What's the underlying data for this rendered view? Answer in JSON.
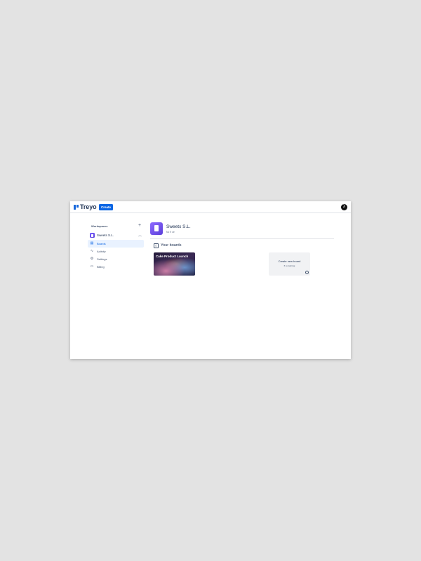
{
  "app": {
    "name": "Treyo",
    "brand_color": "#1868db"
  },
  "topbar": {
    "create_label": "Create",
    "user_initial": "λ"
  },
  "sidebar": {
    "section_title": "Workspaces",
    "add_icon": "plus-icon",
    "workspace_name": "Sweets S.L.",
    "items": [
      {
        "label": "Boards",
        "icon": "board-icon",
        "active": true
      },
      {
        "label": "Activity",
        "icon": "activity-icon",
        "active": false
      },
      {
        "label": "Settings",
        "icon": "gear-icon",
        "active": false
      },
      {
        "label": "Billing",
        "icon": "card-icon",
        "active": false
      }
    ]
  },
  "main": {
    "workspace_name": "Sweets S.L.",
    "workspace_subtitle": "Nc 9 ce",
    "boards_heading": "Your boards",
    "boards": [
      {
        "title": "Cake Product Launch"
      }
    ],
    "new_board": {
      "label": "Create new board",
      "remaining": "6 remaining"
    }
  },
  "colors": {
    "accent": "#0c66e4",
    "active_bg": "#e9f2ff",
    "workspace_avatar": "#6e4ff0"
  }
}
